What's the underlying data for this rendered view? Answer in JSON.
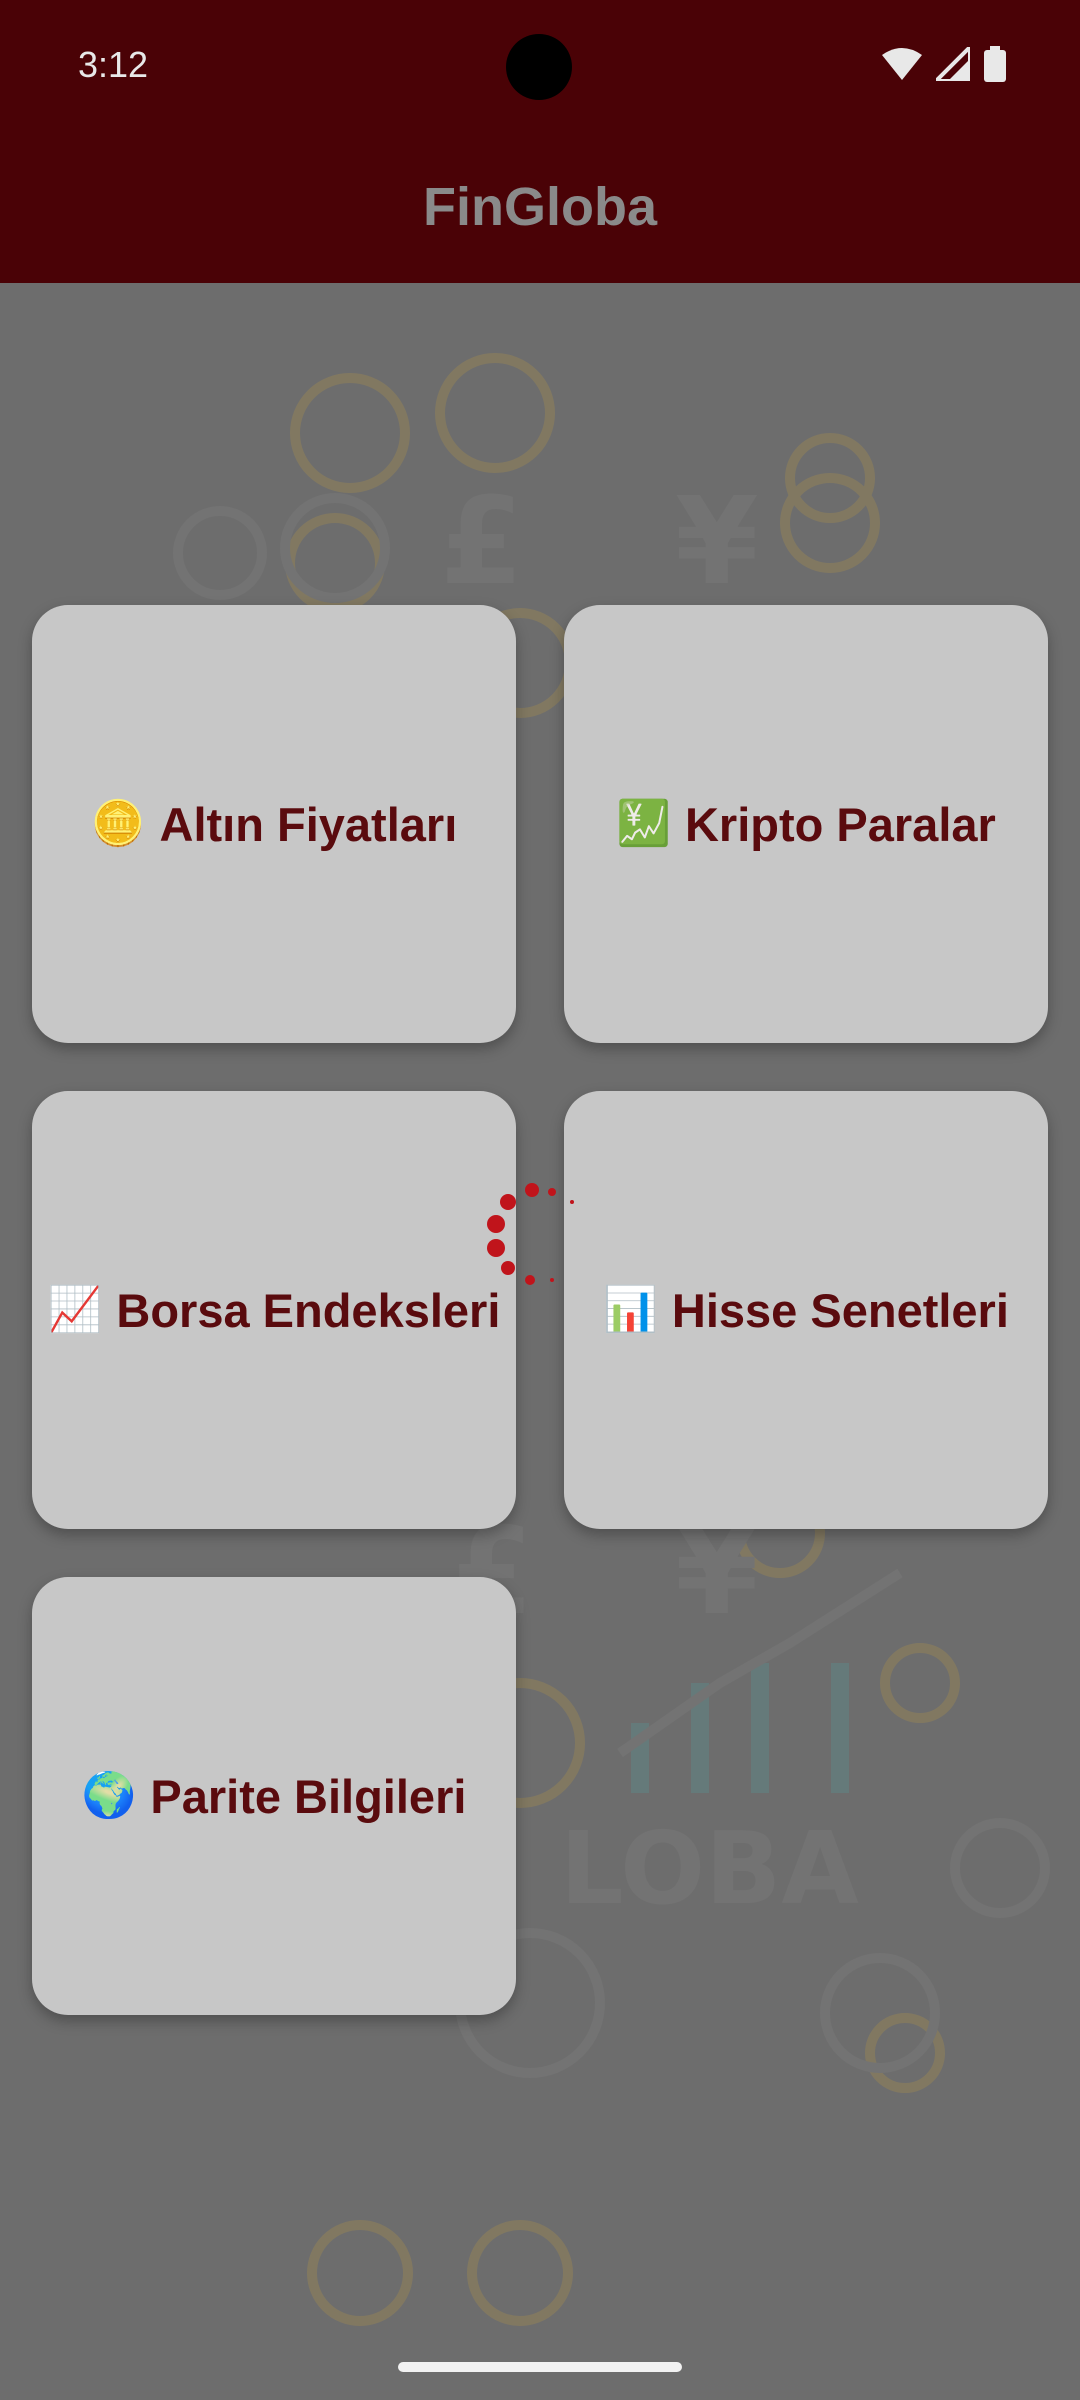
{
  "status_bar": {
    "time": "3:12",
    "icons": [
      "wifi-icon",
      "signal-icon",
      "battery-icon"
    ]
  },
  "app_bar": {
    "title": "FinGloba"
  },
  "menu": {
    "cards": [
      {
        "icon": "🪙",
        "label": "Altın Fiyatları"
      },
      {
        "icon": "💹",
        "label": "Kripto Paralar"
      },
      {
        "icon": "📈",
        "label": "Borsa Endeksleri"
      },
      {
        "icon": "📊",
        "label": "Hisse Senetleri"
      },
      {
        "icon": "🌍",
        "label": "Parite Bilgileri"
      }
    ]
  },
  "colors": {
    "app_bar": "#4a0206",
    "card_text": "#5a0b0e",
    "card_bg": "#c7c7c7",
    "spinner": "#c0141b"
  }
}
